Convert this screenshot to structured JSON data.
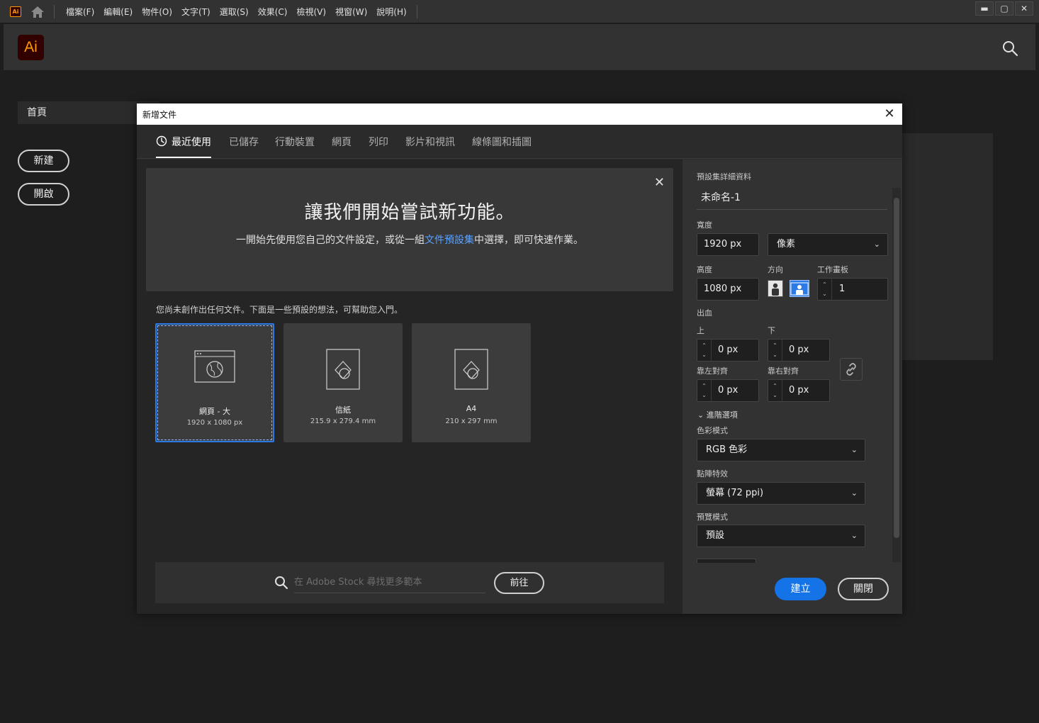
{
  "menubar": {
    "logo": "Ai",
    "items": [
      "檔案(F)",
      "編輯(E)",
      "物件(O)",
      "文字(T)",
      "選取(S)",
      "效果(C)",
      "檢視(V)",
      "視窗(W)",
      "說明(H)"
    ],
    "window_controls": [
      "▬",
      "▢",
      "✕"
    ]
  },
  "header": {
    "logo": "Ai"
  },
  "home": {
    "tab": "首頁",
    "new_button": "新建",
    "open_button": "開啟"
  },
  "dialog": {
    "title": "新增文件",
    "close": "✕",
    "tabs": [
      "最近使用",
      "已儲存",
      "行動裝置",
      "網頁",
      "列印",
      "影片和視訊",
      "線條圖和插圖"
    ],
    "promo": {
      "close": "✕",
      "title": "讓我們開始嘗試新功能。",
      "text_before": "一開始先使用您自己的文件設定，或從一組",
      "link": "文件預設集",
      "text_after": "中選擇，即可快速作業。"
    },
    "hint": "您尚未創作出任何文件。下面是一些預設的想法，可幫助您入門。",
    "presets": [
      {
        "name": "網頁 - 大",
        "size": "1920 x 1080 px",
        "icon": "web-globe-icon"
      },
      {
        "name": "信紙",
        "size": "215.9 x 279.4 mm",
        "icon": "document-shapes-icon"
      },
      {
        "name": "A4",
        "size": "210 x 297 mm",
        "icon": "document-shapes-icon"
      }
    ],
    "stock": {
      "placeholder": "在 Adobe Stock 尋找更多範本",
      "go_button": "前往"
    },
    "details": {
      "section_title": "預設集詳細資料",
      "doc_name": "未命名-1",
      "width_label": "寬度",
      "width_value": "1920 px",
      "unit": "像素",
      "height_label": "高度",
      "height_value": "1080 px",
      "orientation_label": "方向",
      "orientation_selected": "landscape",
      "artboards_label": "工作畫板",
      "artboards_value": "1",
      "bleed_label": "出血",
      "top_label": "上",
      "top_value": "0 px",
      "bottom_label": "下",
      "bottom_value": "0 px",
      "left_label": "靠左對齊",
      "left_value": "0 px",
      "right_label": "靠右對齊",
      "right_value": "0 px",
      "advanced_label": "進階選項",
      "color_mode_label": "色彩模式",
      "color_mode_value": "RGB 色彩",
      "raster_label": "點陣特效",
      "raster_value": "螢幕 (72 ppi)",
      "preview_label": "預覽模式",
      "preview_value": "預設"
    },
    "create_button": "建立",
    "close_button": "關閉"
  },
  "colors": {
    "accent": "#1473e6",
    "link": "#5aa2ff",
    "ai_orange": "#ff9a00"
  }
}
